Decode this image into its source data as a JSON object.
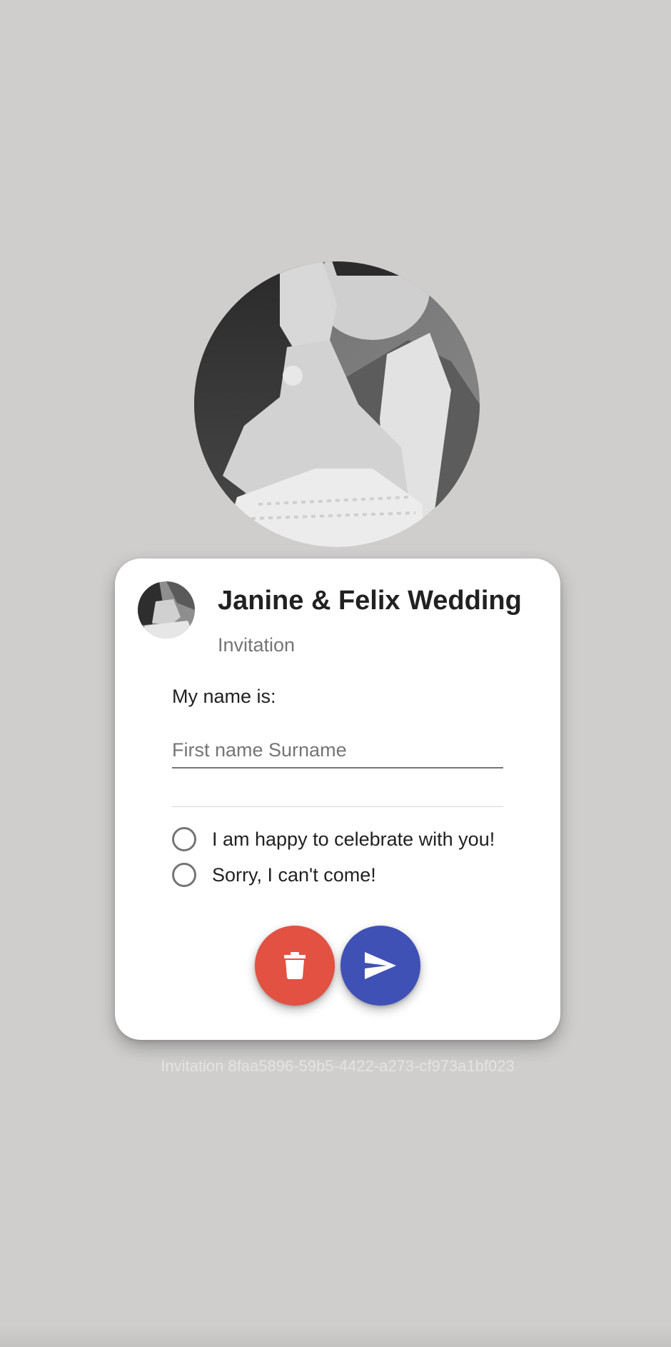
{
  "card": {
    "title": "Janine & Felix Wedding",
    "subtitle": "Invitation"
  },
  "form": {
    "name_label": "My name is:",
    "name_input": {
      "value": "",
      "placeholder": "First name Surname"
    },
    "rsvp_options": [
      {
        "label": "I am happy to celebrate with you!",
        "selected": false
      },
      {
        "label": "Sorry, I can't come!",
        "selected": false
      }
    ]
  },
  "actions": {
    "delete_icon": "trash-icon",
    "send_icon": "send-icon"
  },
  "footer": {
    "invitation_id": "Invitation 8faa5896-59b5-4422-a273-cf973a1bf023"
  },
  "colors": {
    "background": "#cfcecd",
    "card": "#ffffff",
    "delete_button": "#e25142",
    "send_button": "#3f51b5",
    "text_primary": "#212121",
    "text_secondary": "#757575"
  }
}
